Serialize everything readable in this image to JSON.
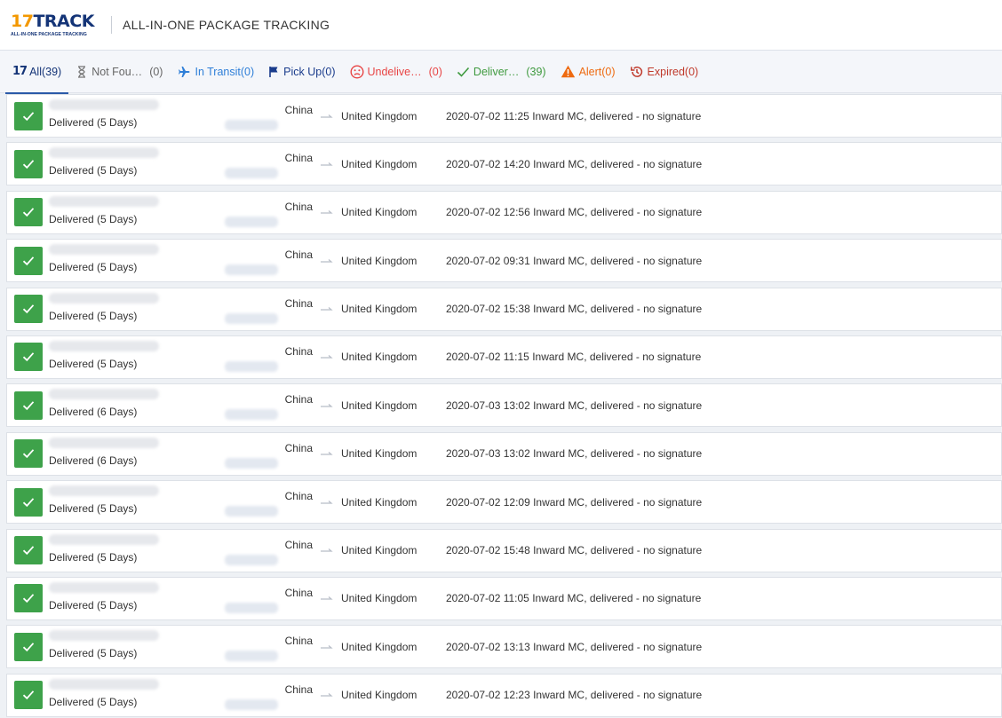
{
  "header": {
    "logo_17": "17",
    "logo_track": "TRACK",
    "logo_sub": "ALL-IN-ONE PACKAGE TRACKING",
    "title": "ALL-IN-ONE PACKAGE TRACKING"
  },
  "tabs": {
    "all": "All(39)",
    "not_found": "Not Fou…",
    "not_found_count": "(0)",
    "in_transit": "In Transit(0)",
    "pick_up": "Pick Up(0)",
    "undelivered": "Undelive…",
    "undelivered_count": "(0)",
    "delivered": "Deliver…",
    "delivered_count": "(39)",
    "alert": "Alert(0)",
    "expired": "Expired(0)"
  },
  "rows": [
    {
      "status": "Delivered (5 Days)",
      "origin": "China",
      "dest": "United Kingdom",
      "event": "2020-07-02 11:25 Inward MC, delivered - no signature"
    },
    {
      "status": "Delivered (5 Days)",
      "origin": "China",
      "dest": "United Kingdom",
      "event": "2020-07-02 14:20 Inward MC, delivered - no signature"
    },
    {
      "status": "Delivered (5 Days)",
      "origin": "China",
      "dest": "United Kingdom",
      "event": "2020-07-02 12:56 Inward MC, delivered - no signature"
    },
    {
      "status": "Delivered (5 Days)",
      "origin": "China",
      "dest": "United Kingdom",
      "event": "2020-07-02 09:31 Inward MC, delivered - no signature"
    },
    {
      "status": "Delivered (5 Days)",
      "origin": "China",
      "dest": "United Kingdom",
      "event": "2020-07-02 15:38 Inward MC, delivered - no signature"
    },
    {
      "status": "Delivered (5 Days)",
      "origin": "China",
      "dest": "United Kingdom",
      "event": "2020-07-02 11:15 Inward MC, delivered - no signature"
    },
    {
      "status": "Delivered (6 Days)",
      "origin": "China",
      "dest": "United Kingdom",
      "event": "2020-07-03 13:02 Inward MC, delivered - no signature"
    },
    {
      "status": "Delivered (6 Days)",
      "origin": "China",
      "dest": "United Kingdom",
      "event": "2020-07-03 13:02 Inward MC, delivered - no signature"
    },
    {
      "status": "Delivered (5 Days)",
      "origin": "China",
      "dest": "United Kingdom",
      "event": "2020-07-02 12:09 Inward MC, delivered - no signature"
    },
    {
      "status": "Delivered (5 Days)",
      "origin": "China",
      "dest": "United Kingdom",
      "event": "2020-07-02 15:48 Inward MC, delivered - no signature"
    },
    {
      "status": "Delivered (5 Days)",
      "origin": "China",
      "dest": "United Kingdom",
      "event": "2020-07-02 11:05 Inward MC, delivered - no signature"
    },
    {
      "status": "Delivered (5 Days)",
      "origin": "China",
      "dest": "United Kingdom",
      "event": "2020-07-02 13:13 Inward MC, delivered - no signature"
    },
    {
      "status": "Delivered (5 Days)",
      "origin": "China",
      "dest": "United Kingdom",
      "event": "2020-07-02 12:23 Inward MC, delivered - no signature"
    }
  ],
  "colors": {
    "brand_orange": "#f39800",
    "brand_navy": "#143477",
    "delivered_green": "#3ea24a"
  },
  "icons": {
    "check": "check-icon",
    "arrow": "arrow-right-icon"
  }
}
